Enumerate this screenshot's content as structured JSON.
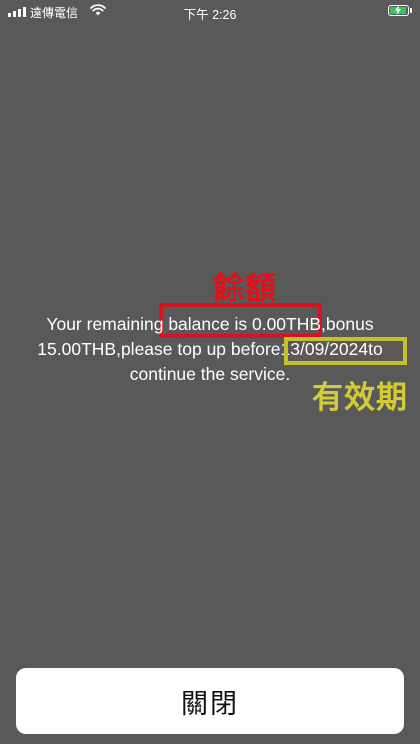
{
  "status_bar": {
    "carrier": "遠傳電信",
    "time": "下午 2:26",
    "signal_icon": "cellular-signal-icon",
    "wifi_icon": "wifi-icon",
    "battery_icon": "battery-charging-icon",
    "battery_color": "#34c759"
  },
  "message": {
    "text": "Your remaining balance is 0.00THB,bonus 15.00THB,please top up before13/09/2024to continue the service."
  },
  "annotations": {
    "balance_label": "餘額",
    "balance_color": "#e3101a",
    "expiry_label": "有效期",
    "expiry_color": "#d3cc34"
  },
  "actions": {
    "close_label": "關閉"
  },
  "colors": {
    "background": "#595959",
    "button": "#ffffff"
  }
}
